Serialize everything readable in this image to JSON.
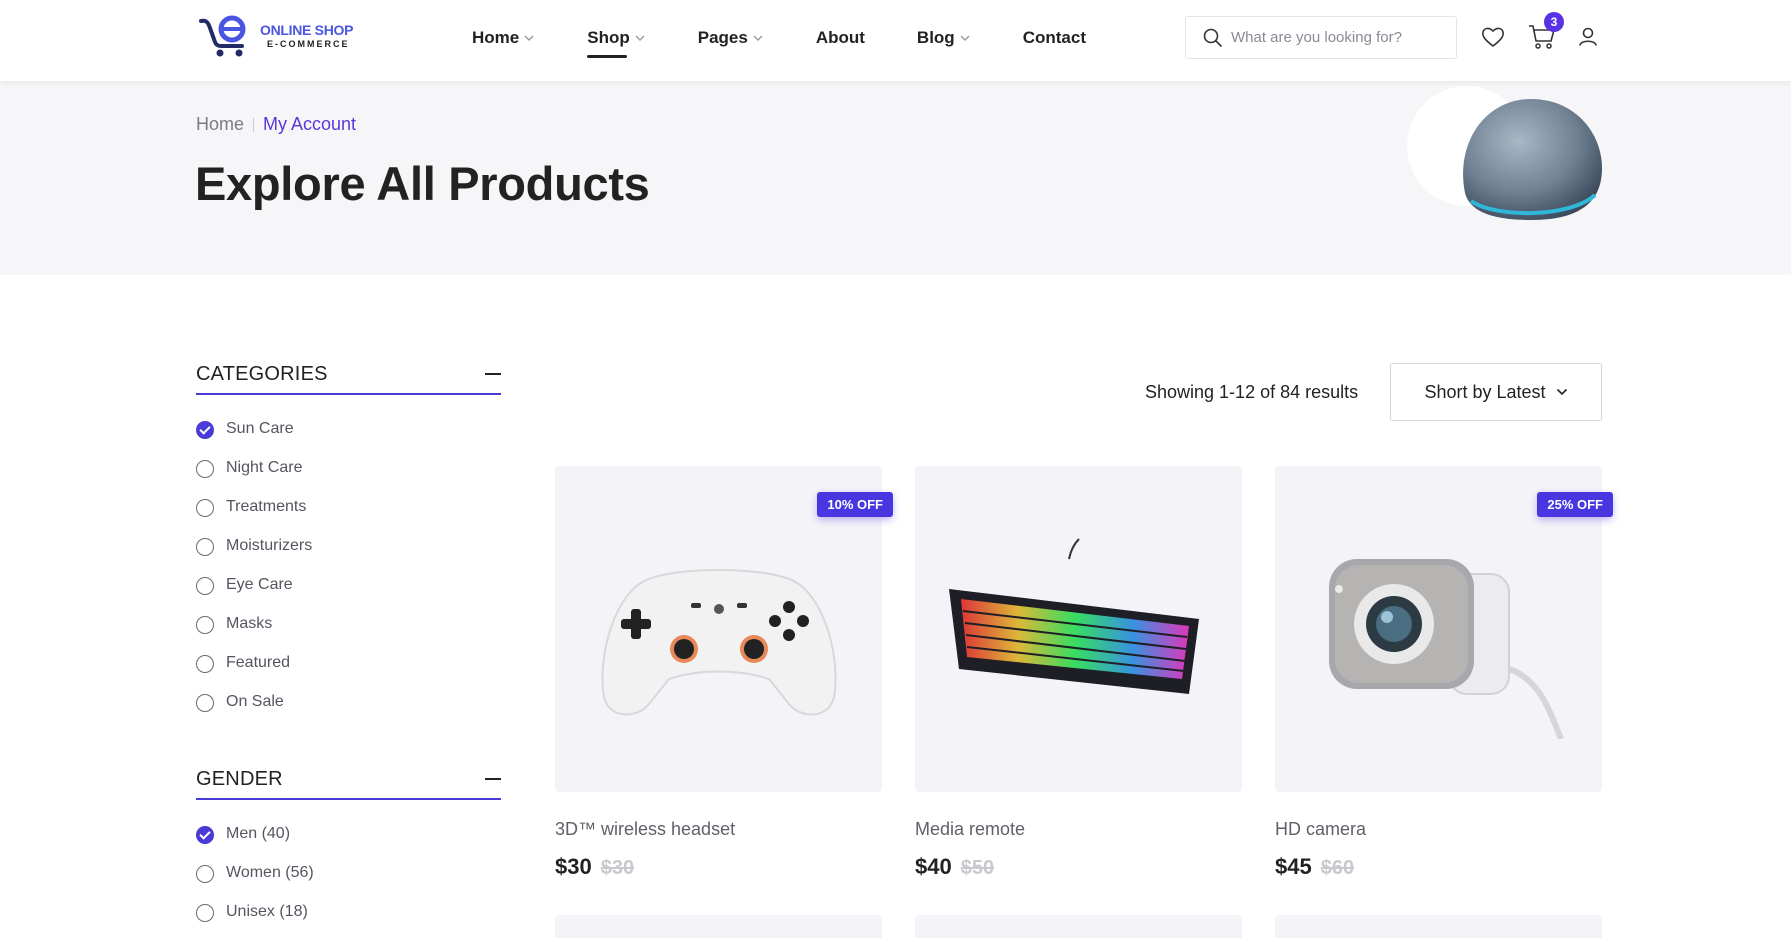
{
  "brand": {
    "title": "ONLINE SHOP",
    "subtitle": "E-COMMERCE"
  },
  "nav": {
    "items": [
      {
        "label": "Home",
        "has_dropdown": true,
        "active": false
      },
      {
        "label": "Shop",
        "has_dropdown": true,
        "active": true
      },
      {
        "label": "Pages",
        "has_dropdown": true,
        "active": false
      },
      {
        "label": "About",
        "has_dropdown": false,
        "active": false
      },
      {
        "label": "Blog",
        "has_dropdown": true,
        "active": false
      },
      {
        "label": "Contact",
        "has_dropdown": false,
        "active": false
      }
    ]
  },
  "search": {
    "placeholder": "What are you looking for?"
  },
  "cart": {
    "count": "3"
  },
  "breadcrumb": {
    "home": "Home",
    "current": "My Account"
  },
  "hero": {
    "title": "Explore All Products"
  },
  "filters": {
    "categories": {
      "title": "CATEGORIES",
      "options": [
        {
          "label": "Sun Care",
          "checked": true
        },
        {
          "label": "Night Care",
          "checked": false
        },
        {
          "label": "Treatments",
          "checked": false
        },
        {
          "label": "Moisturizers",
          "checked": false
        },
        {
          "label": "Eye Care",
          "checked": false
        },
        {
          "label": "Masks",
          "checked": false
        },
        {
          "label": "Featured",
          "checked": false
        },
        {
          "label": "On Sale",
          "checked": false
        }
      ]
    },
    "gender": {
      "title": "GENDER",
      "options": [
        {
          "label": "Men (40)",
          "checked": true
        },
        {
          "label": "Women (56)",
          "checked": false
        },
        {
          "label": "Unisex (18)",
          "checked": false
        }
      ]
    }
  },
  "toolbar": {
    "results_text": "Showing 1-12 of 84 results",
    "sort_label": "Short by Latest"
  },
  "products": [
    {
      "name": "3D™ wireless headset",
      "price": "$30",
      "old_price": "$30",
      "badge": "10% OFF",
      "icon": "gamepad-image"
    },
    {
      "name": "Media remote",
      "price": "$40",
      "old_price": "$50",
      "badge": "",
      "icon": "keyboard-image"
    },
    {
      "name": "HD camera",
      "price": "$45",
      "old_price": "$60",
      "badge": "25% OFF",
      "icon": "webcam-image"
    }
  ],
  "colors": {
    "accent": "#4a36e0",
    "brand": "#4a56e2",
    "hero_bg": "#f6f6f8"
  }
}
